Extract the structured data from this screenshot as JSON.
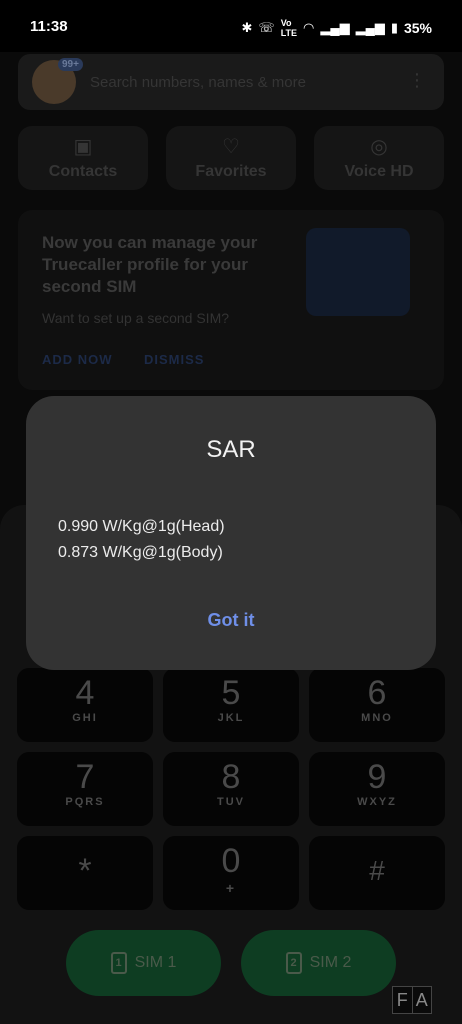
{
  "status_bar": {
    "time": "11:38",
    "icons": [
      "bluetooth-icon",
      "volte-call-icon",
      "vowifi-lte-icon",
      "wifi-icon",
      "signal-icon",
      "signal-icon",
      "battery-icon"
    ],
    "battery": "35%"
  },
  "search": {
    "placeholder": "Search numbers, names & more",
    "badge": "99+"
  },
  "shortcuts": [
    {
      "label": "Contacts",
      "icon": "contacts-icon"
    },
    {
      "label": "Favorites",
      "icon": "heart-icon"
    },
    {
      "label": "Voice HD",
      "icon": "voice-hd-icon"
    }
  ],
  "promo": {
    "title": "Now you can manage your Truecaller profile for your second SIM",
    "subtitle": "Want to set up a second SIM?",
    "add_now": "ADD NOW",
    "dismiss": "DISMISS"
  },
  "keypad": [
    {
      "digit": "4",
      "letters": "GHI"
    },
    {
      "digit": "5",
      "letters": "JKL"
    },
    {
      "digit": "6",
      "letters": "MNO"
    },
    {
      "digit": "7",
      "letters": "PQRS"
    },
    {
      "digit": "8",
      "letters": "TUV"
    },
    {
      "digit": "9",
      "letters": "WXYZ"
    },
    {
      "digit": "*",
      "letters": ""
    },
    {
      "digit": "0",
      "letters": "+"
    },
    {
      "digit": "#",
      "letters": ""
    }
  ],
  "sim_buttons": [
    {
      "number": "1",
      "label": "SIM 1"
    },
    {
      "number": "2",
      "label": "SIM 2"
    }
  ],
  "watermark": [
    "F",
    "A"
  ],
  "dialog": {
    "title": "SAR",
    "line_head": "0.990 W/Kg@1g(Head)",
    "line_body": "0.873 W/Kg@1g(Body)",
    "confirm": "Got it"
  }
}
